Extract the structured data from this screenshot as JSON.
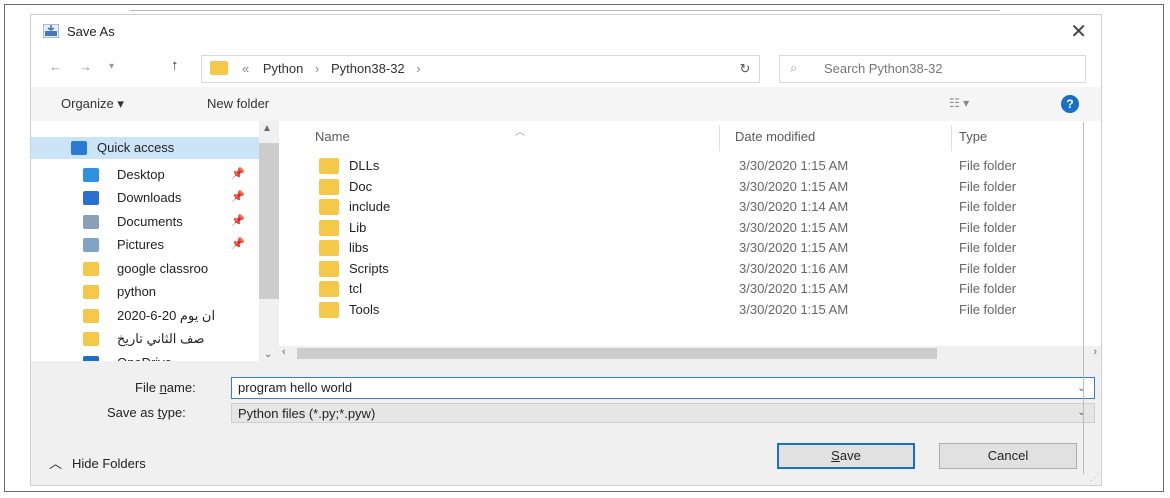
{
  "dialog": {
    "title": "Save As"
  },
  "address": {
    "overflow": "«",
    "segments": [
      "Python",
      "Python38-32"
    ],
    "separator": "›"
  },
  "search": {
    "placeholder": "Search Python38-32"
  },
  "toolbar": {
    "organize": "Organize ▾",
    "new_folder": "New folder",
    "view": "☷ ▾",
    "help": "?"
  },
  "nav": {
    "items": [
      {
        "label": "Quick access",
        "icon": "star-icon",
        "color": "#2b7bd6",
        "pinned": false
      },
      {
        "label": "Desktop",
        "icon": "desktop-icon",
        "color": "#2f8fe0",
        "pinned": true
      },
      {
        "label": "Downloads",
        "icon": "download-icon",
        "color": "#2b6fd1",
        "pinned": true
      },
      {
        "label": "Documents",
        "icon": "documents-icon",
        "color": "#8aa0b6",
        "pinned": true
      },
      {
        "label": "Pictures",
        "icon": "pictures-icon",
        "color": "#7fa4c4",
        "pinned": true
      },
      {
        "label": "google classroo",
        "icon": "folder-icon",
        "color": "#f5c84a",
        "pinned": false
      },
      {
        "label": "python",
        "icon": "folder-icon",
        "color": "#f5c84a",
        "pinned": false
      },
      {
        "label": "ان يوم 20-6-2020",
        "icon": "folder-icon",
        "color": "#f5c84a",
        "pinned": false
      },
      {
        "label": "صف الثاني تاريخ",
        "icon": "folder-icon",
        "color": "#f5c84a",
        "pinned": false
      },
      {
        "label": "OneDrive",
        "icon": "onedrive-icon",
        "color": "#1a6fc9",
        "pinned": false
      }
    ]
  },
  "columns": {
    "name": "Name",
    "date": "Date modified",
    "type": "Type"
  },
  "files": [
    {
      "name": "DLLs",
      "date": "3/30/2020 1:15 AM",
      "type": "File folder"
    },
    {
      "name": "Doc",
      "date": "3/30/2020 1:15 AM",
      "type": "File folder"
    },
    {
      "name": "include",
      "date": "3/30/2020 1:14 AM",
      "type": "File folder"
    },
    {
      "name": "Lib",
      "date": "3/30/2020 1:15 AM",
      "type": "File folder"
    },
    {
      "name": "libs",
      "date": "3/30/2020 1:15 AM",
      "type": "File folder"
    },
    {
      "name": "Scripts",
      "date": "3/30/2020 1:16 AM",
      "type": "File folder"
    },
    {
      "name": "tcl",
      "date": "3/30/2020 1:15 AM",
      "type": "File folder"
    },
    {
      "name": "Tools",
      "date": "3/30/2020 1:15 AM",
      "type": "File folder"
    }
  ],
  "form": {
    "file_name_label_pre": "File ",
    "file_name_label_u": "n",
    "file_name_label_post": "ame:",
    "file_name_value": "program hello world",
    "save_type_label_pre": "Save as ",
    "save_type_label_u": "t",
    "save_type_label_post": "ype:",
    "save_type_value": "Python files (*.py;*.pyw)"
  },
  "footer": {
    "hide_folders": "Hide Folders",
    "save_u": "S",
    "save_rest": "ave",
    "cancel": "Cancel"
  }
}
